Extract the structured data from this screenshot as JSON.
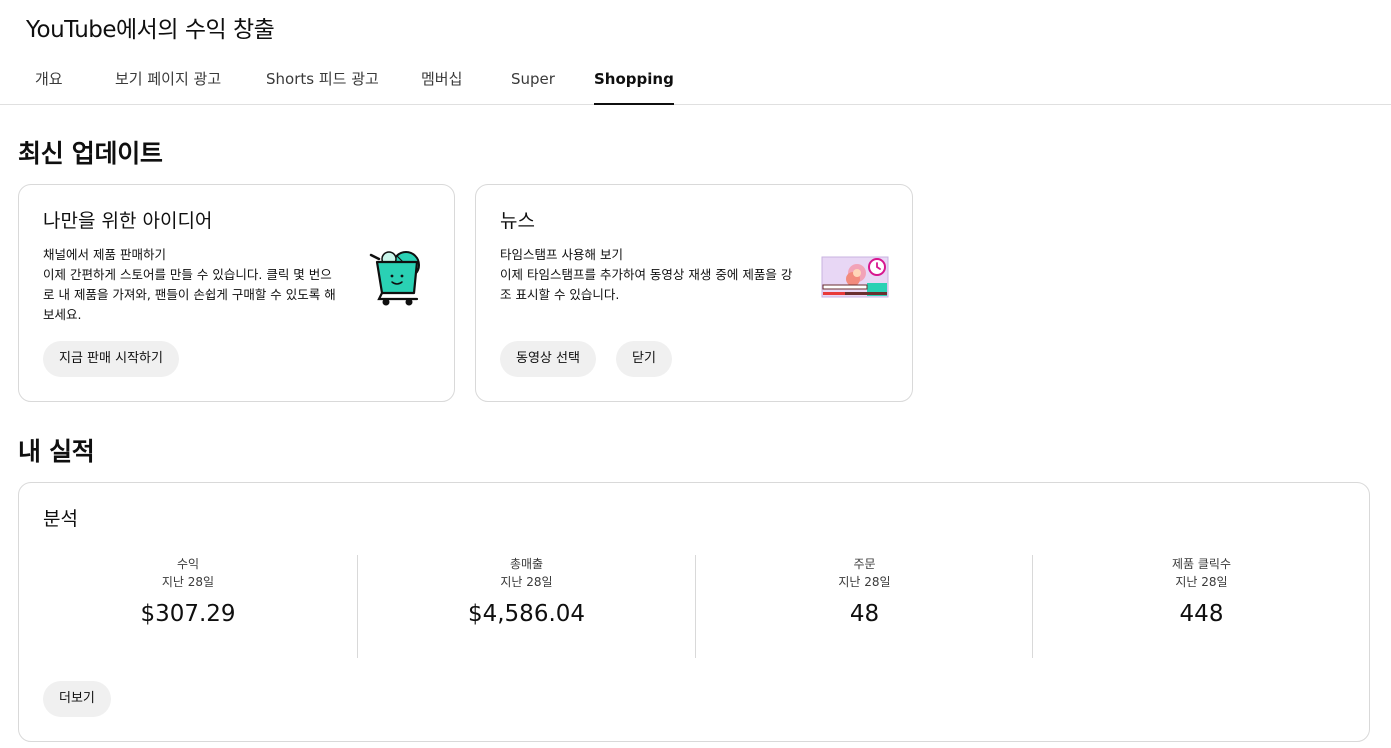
{
  "header": {
    "title": "YouTube에서의 수익 창출"
  },
  "tabs": [
    {
      "label": "개요"
    },
    {
      "label": "보기 페이지 광고"
    },
    {
      "label": "Shorts 피드 광고"
    },
    {
      "label": "멤버십"
    },
    {
      "label": "Super"
    },
    {
      "label": "Shopping",
      "active": true
    }
  ],
  "updates": {
    "title": "최신 업데이트",
    "ideas": {
      "title": "나만을 위한 아이디어",
      "heading": "채널에서 제품 판매하기",
      "body": "이제 간편하게 스토어를 만들 수 있습니다. 클릭 몇 번으로 내 제품을 가져와, 팬들이 손쉽게 구매할 수 있도록 해보세요.",
      "button": "지금 판매 시작하기",
      "icon": "shopping-cart-illustration"
    },
    "news": {
      "title": "뉴스",
      "heading": "타임스탬프 사용해 보기",
      "body": "이제 타임스탬프를 추가하여 동영상 재생 중에 제품을 강조 표시할 수 있습니다.",
      "button_primary": "동영상 선택",
      "button_secondary": "닫기",
      "icon": "video-timestamp-illustration"
    }
  },
  "performance": {
    "title": "내 실적",
    "card_title": "분석",
    "metrics": [
      {
        "label": "수익",
        "period": "지난 28일",
        "value": "$307.29"
      },
      {
        "label": "총매출",
        "period": "지난 28일",
        "value": "$4,586.04"
      },
      {
        "label": "주문",
        "period": "지난 28일",
        "value": "48"
      },
      {
        "label": "제품 클릭수",
        "period": "지난 28일",
        "value": "448"
      }
    ],
    "more_button": "더보기"
  },
  "colors": {
    "accent_teal": "#2ad1b4",
    "illustration_pink": "#f2a3b8",
    "illustration_clock": "#d7168f"
  }
}
